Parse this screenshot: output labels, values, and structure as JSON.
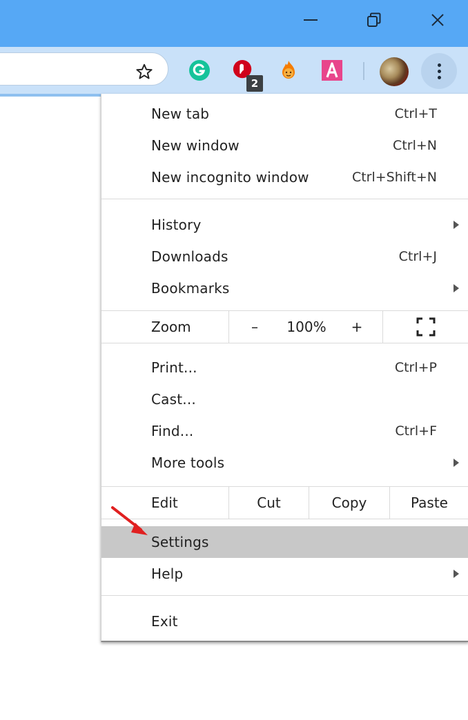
{
  "window_controls": {
    "minimize_icon": "minimize-icon",
    "restore_icon": "restore-icon",
    "close_icon": "close-icon"
  },
  "toolbar": {
    "bookmark_icon": "star-icon",
    "extensions": [
      {
        "name": "grammarly-extension",
        "glyph": "G",
        "color": "#15c39a"
      },
      {
        "name": "adblock-extension",
        "glyph": "",
        "color": "#d0021b",
        "badge": "2"
      },
      {
        "name": "hola-fire-extension",
        "glyph": "",
        "color": "#f57c00"
      },
      {
        "name": "a-extension",
        "glyph": "A",
        "color": "#e8458b"
      }
    ],
    "menu_icon": "three-dots-vertical-icon"
  },
  "menu": {
    "groups": [
      [
        {
          "label": "New tab",
          "shortcut": "Ctrl+T"
        },
        {
          "label": "New window",
          "shortcut": "Ctrl+N"
        },
        {
          "label": "New incognito window",
          "shortcut": "Ctrl+Shift+N"
        }
      ],
      [
        {
          "label": "History",
          "submenu": true
        },
        {
          "label": "Downloads",
          "shortcut": "Ctrl+J"
        },
        {
          "label": "Bookmarks",
          "submenu": true
        }
      ]
    ],
    "zoom": {
      "label": "Zoom",
      "minus": "–",
      "value": "100%",
      "plus": "+",
      "fullscreen_icon": "fullscreen-icon"
    },
    "tools": [
      {
        "label": "Print...",
        "shortcut": "Ctrl+P"
      },
      {
        "label": "Cast..."
      },
      {
        "label": "Find...",
        "shortcut": "Ctrl+F"
      },
      {
        "label": "More tools",
        "submenu": true
      }
    ],
    "edit": {
      "label": "Edit",
      "cut": "Cut",
      "copy": "Copy",
      "paste": "Paste"
    },
    "settings": {
      "label": "Settings",
      "highlighted": true
    },
    "help": {
      "label": "Help",
      "submenu": true
    },
    "exit": {
      "label": "Exit"
    }
  },
  "annotation": {
    "arrow_color": "#e02020",
    "points_to": "Settings"
  }
}
